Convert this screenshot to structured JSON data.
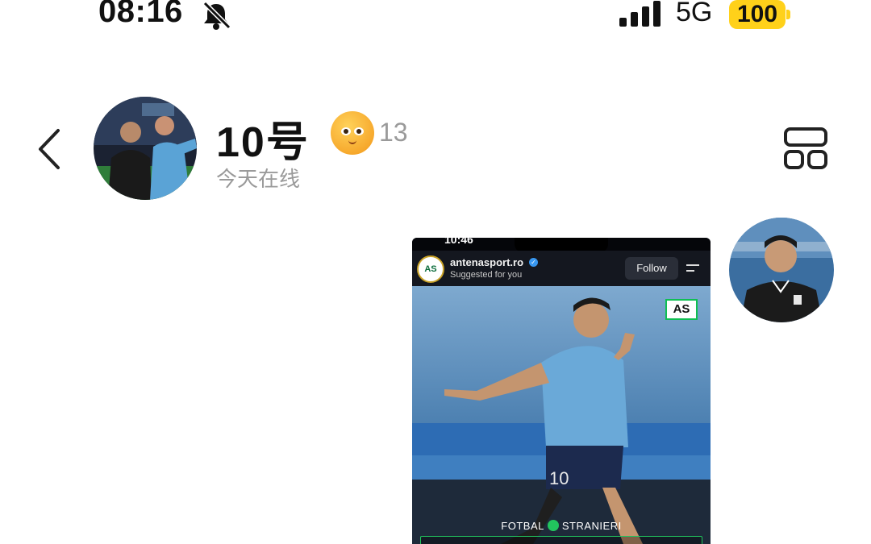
{
  "status_bar": {
    "time": "08:16",
    "network": "5G",
    "battery": "100",
    "battery_color": "#ffd11a"
  },
  "header": {
    "contact_name": "10号",
    "emoji_reaction_count": "13",
    "presence": "今天在线",
    "icons": {
      "back": "chevron-left-icon",
      "layout": "grid-layout-icon",
      "mute": "bell-slash-icon"
    }
  },
  "message": {
    "shared_post": {
      "time": "10:46",
      "account": "antenasport.ro",
      "subtitle": "Suggested for you",
      "follow_label": "Follow",
      "badge": "AS",
      "logo_text": "AS",
      "caption_left": "FOTBAL",
      "caption_right": "STRANIERI",
      "jersey_number": "10"
    }
  },
  "colors": {
    "accent_green": "#22c55e",
    "jersey_blue": "#5fa8d8",
    "secondary_text": "#9a9a9a"
  }
}
